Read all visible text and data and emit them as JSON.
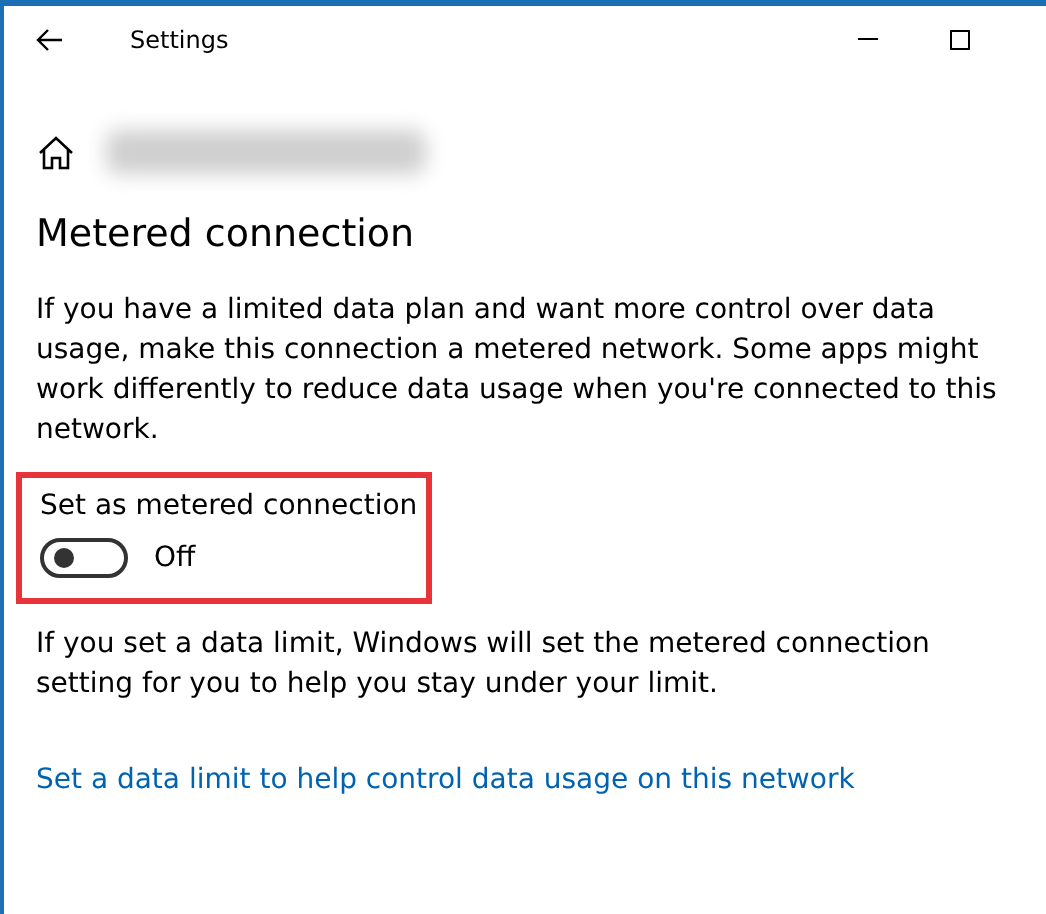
{
  "window": {
    "title": "Settings"
  },
  "page": {
    "heading": "Metered connection",
    "description": "If you have a limited data plan and want more control over data usage, make this connection a metered network. Some apps might work differently to reduce data usage when you're connected to this network."
  },
  "metered_toggle": {
    "label": "Set as metered connection",
    "on": false,
    "state_text": "Off"
  },
  "note": "If you set a data limit, Windows will set the metered connection setting for you to help you stay under your limit.",
  "link": "Set a data limit to help control data usage on this network"
}
